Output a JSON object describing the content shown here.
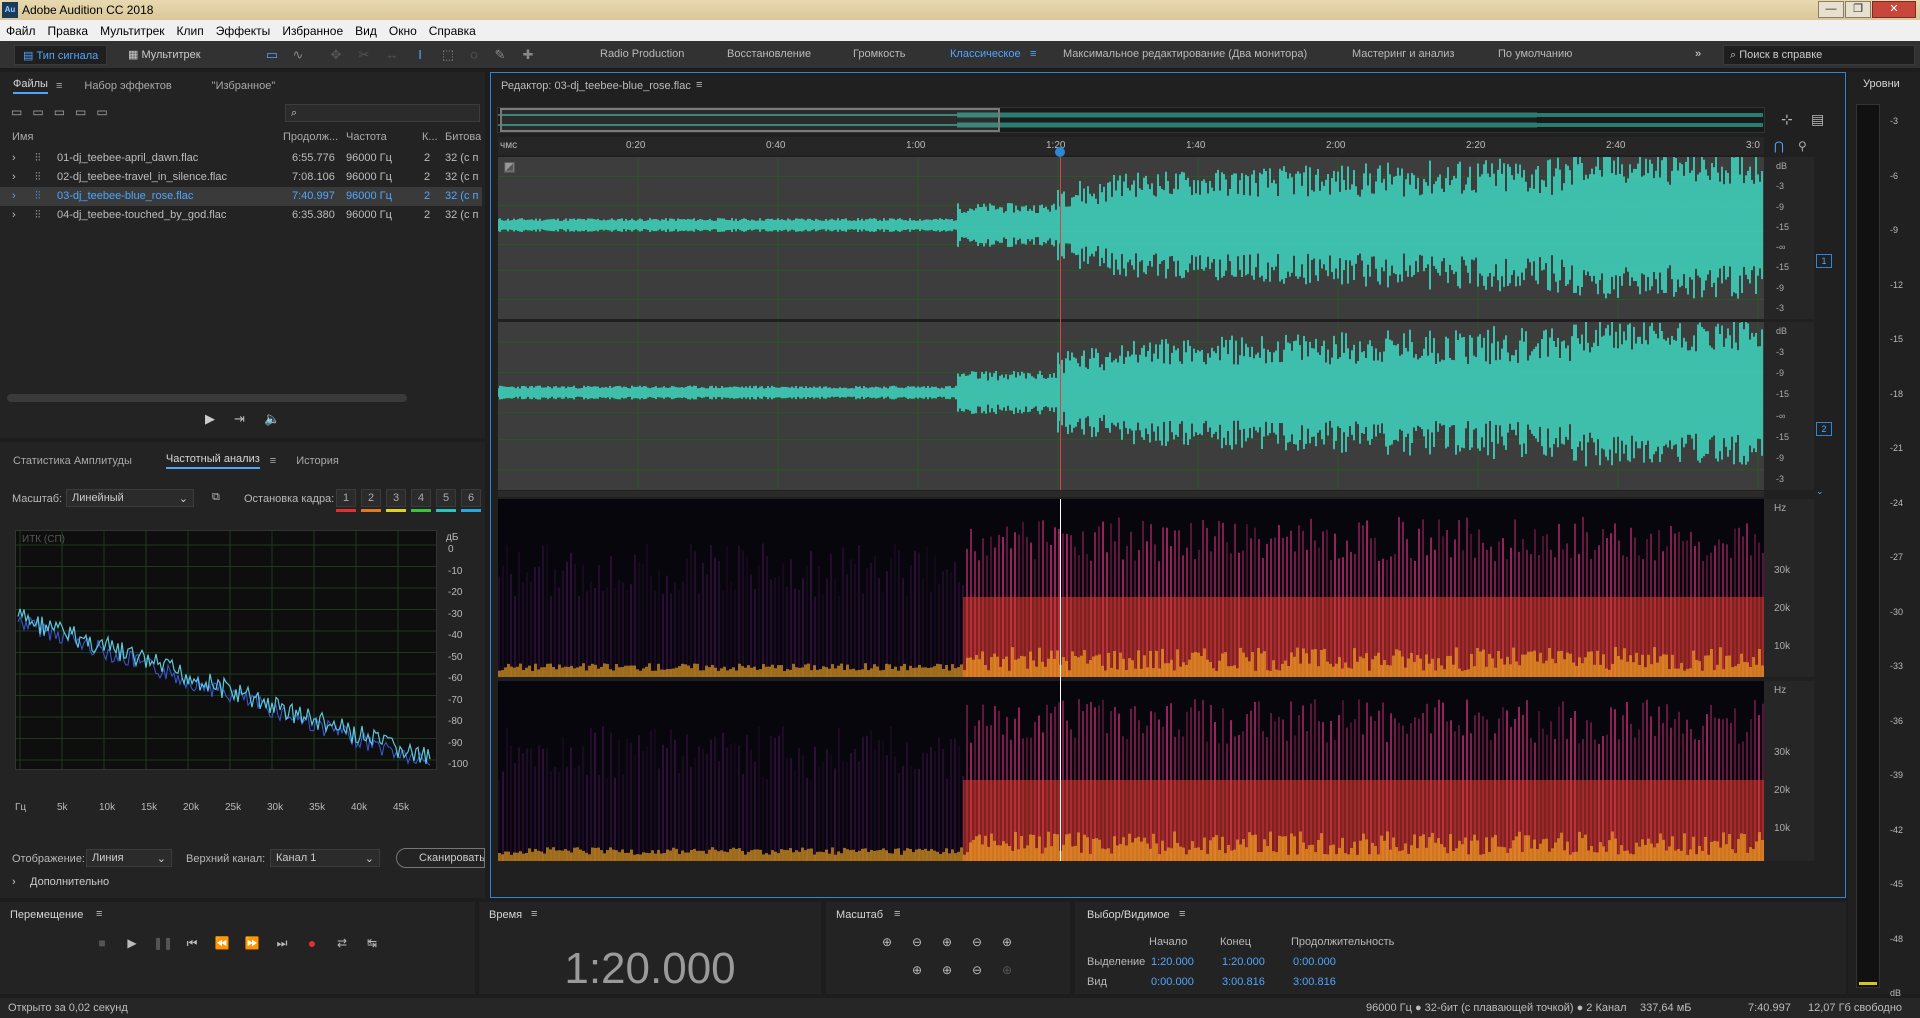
{
  "app_title": "Adobe Audition CC 2018",
  "window_buttons": {
    "minimize": "—",
    "maximize": "❐",
    "close": "✕"
  },
  "menu": [
    "Файл",
    "Правка",
    "Мультитрек",
    "Клип",
    "Эффекты",
    "Избранное",
    "Вид",
    "Окно",
    "Справка"
  ],
  "toolbar": {
    "mode_waveform": "Тип сигнала",
    "mode_multitrack": "Мультитрек",
    "workspaces": [
      "Radio Production",
      "Восстановление",
      "Громкость",
      "Классическое",
      "Максимальное редактирование (Два монитора)",
      "Мастеринг и анализ",
      "По умолчанию"
    ],
    "active_workspace": "Классическое",
    "more": "»",
    "help_placeholder": "Поиск в справке"
  },
  "files_panel": {
    "tabs": [
      "Файлы",
      "Набор эффектов",
      "\"Избранное\""
    ],
    "columns": [
      "Имя",
      "Продолж...",
      "Частота",
      "К...",
      "Битова"
    ],
    "rows": [
      {
        "name": "01-dj_teebee-april_dawn.flac",
        "duration": "6:55.776",
        "rate": "96000 Гц",
        "ch": "2",
        "bits": "32 (с п"
      },
      {
        "name": "02-dj_teebee-travel_in_silence.flac",
        "duration": "7:08.106",
        "rate": "96000 Гц",
        "ch": "2",
        "bits": "32 (с п"
      },
      {
        "name": "03-dj_teebee-blue_rose.flac",
        "duration": "7:40.997",
        "rate": "96000 Гц",
        "ch": "2",
        "bits": "32 (с п"
      },
      {
        "name": "04-dj_teebee-touched_by_god.flac",
        "duration": "6:35.380",
        "rate": "96000 Гц",
        "ch": "2",
        "bits": "32 (с п"
      }
    ],
    "selected_row": 2,
    "search_icon": "search-icon"
  },
  "analysis_panel": {
    "tabs": [
      "Статистика Амплитуды",
      "Частотный анализ",
      "История"
    ],
    "scale_label": "Масштаб:",
    "scale_value": "Линейный",
    "freeze_label": "Остановка кадра:",
    "freeze_buttons": [
      "1",
      "2",
      "3",
      "4",
      "5",
      "6"
    ],
    "freeze_colors": [
      "#e03030",
      "#e07a20",
      "#e0d020",
      "#40c040",
      "#30c0c0",
      "#2aa7d8"
    ],
    "graph_label": "ИТК (СП)",
    "db_unit": "дБ",
    "db_ticks": [
      "0",
      "-10",
      "-20",
      "-30",
      "-40",
      "-50",
      "-60",
      "-70",
      "-80",
      "-90",
      "-100"
    ],
    "freq_ticks": [
      "Гц",
      "5k",
      "10k",
      "15k",
      "20k",
      "25k",
      "30k",
      "35k",
      "40k",
      "45k"
    ],
    "display_label": "Отображение:",
    "display_value": "Линия",
    "channel_label": "Верхний канал:",
    "channel_value": "Канал 1",
    "scan_button": "Сканировать",
    "more_label": "Дополнительно"
  },
  "editor": {
    "title": "Редактор: 03-dj_teebee-blue_rose.flac",
    "ruler": [
      "чмс",
      "0:20",
      "0:40",
      "1:00",
      "1:20",
      "1:40",
      "2:00",
      "2:20",
      "2:40",
      "3:0"
    ],
    "db_ticks_ch": [
      "dB",
      "-3",
      "-9",
      "-15",
      "-∞",
      "-15",
      "-9",
      "-3"
    ],
    "channels": [
      "1",
      "2"
    ],
    "hz_ticks": [
      "Hz",
      "30k",
      "20k",
      "10k"
    ],
    "playhead_fraction": 0.444,
    "accent": "#3fe0c8"
  },
  "level_panel": {
    "title": "Уровни",
    "ticks": [
      "-3",
      "-6",
      "-9",
      "-12",
      "-15",
      "-18",
      "-21",
      "-24",
      "-27",
      "-30",
      "-33",
      "-36",
      "-39",
      "-42",
      "-45",
      "-48",
      "dB"
    ]
  },
  "transport": {
    "title": "Перемещение"
  },
  "time_panel": {
    "title": "Время",
    "value": "1:20.000"
  },
  "zoom_panel": {
    "title": "Масштаб"
  },
  "selection_panel": {
    "title": "Выбор/Видимое",
    "headers": [
      "Начало",
      "Конец",
      "Продолжительность"
    ],
    "rows": [
      {
        "label": "Выделение",
        "start": "1:20.000",
        "end": "1:20.000",
        "dur": "0:00.000"
      },
      {
        "label": "Вид",
        "start": "0:00.000",
        "end": "3:00.816",
        "dur": "3:00.816"
      }
    ]
  },
  "status": {
    "left": "Открыто за 0,02 секунд",
    "format": "96000 Гц ● 32-бит (с плавающей точкой) ● 2 Канал",
    "size": "337,64 мБ",
    "duration": "7:40.997",
    "free": "12,07 Гб свободно"
  }
}
